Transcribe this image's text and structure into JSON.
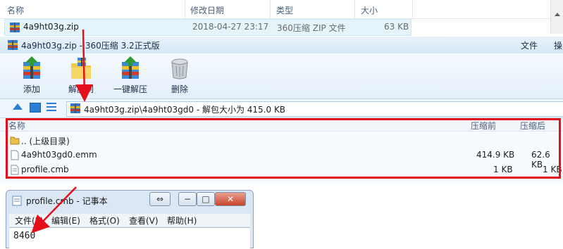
{
  "explorer": {
    "headers": {
      "name": "名称",
      "modified": "修改日期",
      "type": "类型",
      "size": "大小"
    },
    "file": {
      "name": "4a9ht03g.zip",
      "modified": "2018-04-27 23:17",
      "type": "360压缩 ZIP 文件",
      "size": "63 KB"
    }
  },
  "zip_window": {
    "title": "4a9ht03g.zip - 360压缩 3.2正式版",
    "menu": [
      "文件",
      "操"
    ],
    "toolbar": [
      {
        "label": "添加",
        "icon": "add-archive-icon"
      },
      {
        "label": "解压到",
        "icon": "extract-to-icon"
      },
      {
        "label": "一键解压",
        "icon": "one-click-extract-icon"
      },
      {
        "label": "删除",
        "icon": "delete-icon"
      }
    ],
    "address": "4a9ht03g.zip\\4a9ht03gd0 - 解包大小为 415.0 KB",
    "list_headers": {
      "name": "名称",
      "packed": "压缩前",
      "compressed": "压缩后"
    },
    "rows": [
      {
        "name": ".. (上级目录)",
        "packed": "",
        "compressed": "",
        "icon": "folder-icon"
      },
      {
        "name": "4a9ht03gd0.emm",
        "packed": "414.9 KB",
        "compressed": "62.6 KB",
        "icon": "file-icon"
      },
      {
        "name": "profile.cmb",
        "packed": "1 KB",
        "compressed": "1 KB",
        "icon": "file-icon"
      }
    ]
  },
  "notepad": {
    "title": "profile.cmb - 记事本",
    "menu": [
      "文件(F)",
      "编辑(E)",
      "格式(O)",
      "查看(V)",
      "帮助(H)"
    ],
    "content": "8460"
  },
  "colors": {
    "annotation": "#e3101c",
    "selection": "#e5f3fb"
  }
}
